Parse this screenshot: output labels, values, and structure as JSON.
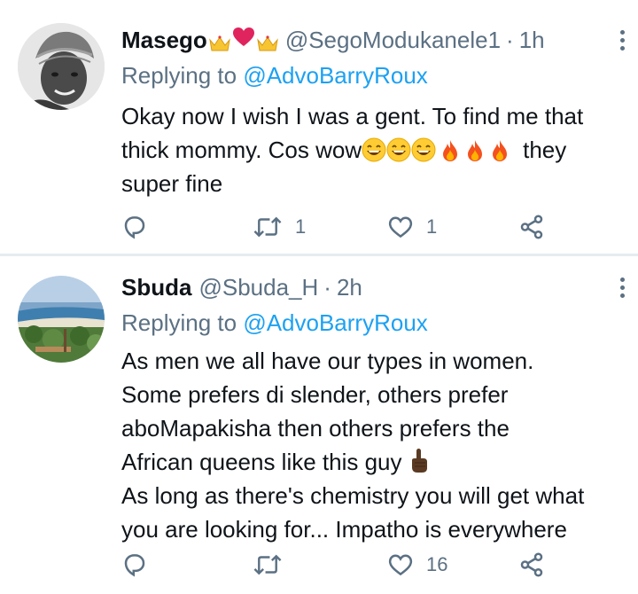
{
  "colors": {
    "text": "#0f1419",
    "secondary": "#5b7083",
    "link": "#1da1f2",
    "divider": "#e6ecf0"
  },
  "tweets": [
    {
      "display_name": "Masego",
      "handle": "@SegoModukanele1",
      "time": "1h",
      "replying_prefix": "Replying to",
      "replying_to": "@AdvoBarryRoux",
      "lines": [
        "Okay now I wish I was a gent. To find me that",
        "thick mommy.  Cos wow",
        "they",
        "super fine"
      ],
      "replies": "",
      "retweets": "1",
      "likes": "1",
      "name_emoji": [
        "crown-icon",
        "heart-icon",
        "crown-icon"
      ]
    },
    {
      "display_name": "Sbuda",
      "handle": "@Sbuda_H",
      "time": "2h",
      "replying_prefix": "Replying to",
      "replying_to": "@AdvoBarryRoux",
      "lines": [
        "As men we all have our types in women.",
        "Some prefers di slender, others prefer",
        "aboMapakisha then others prefers the",
        "African queens like this guy",
        "As long as there's chemistry you will get what",
        "you are looking for... Impatho is everywhere"
      ],
      "replies": "",
      "retweets": "",
      "likes": "16"
    }
  ]
}
